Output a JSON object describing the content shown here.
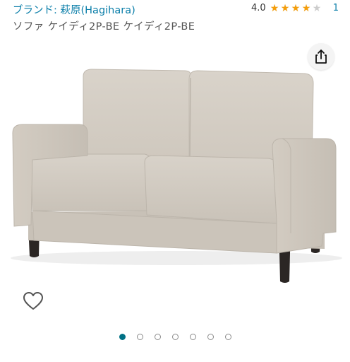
{
  "product": {
    "brand_label": "ブランド: 萩原(Hagihara)",
    "title": "ソファ ケイディ2P-BE ケイディ2P-BE",
    "rating_value": "4.0",
    "rating_stars": 4.0,
    "review_count": "1"
  },
  "icons": {
    "share": "share-icon",
    "wishlist": "heart-outline-icon",
    "star": "star-icon"
  },
  "carousel": {
    "total": 7,
    "active_index": 0
  },
  "colors": {
    "link": "#0a7ea9",
    "star": "#f59e0b",
    "active_dot": "#007185"
  }
}
